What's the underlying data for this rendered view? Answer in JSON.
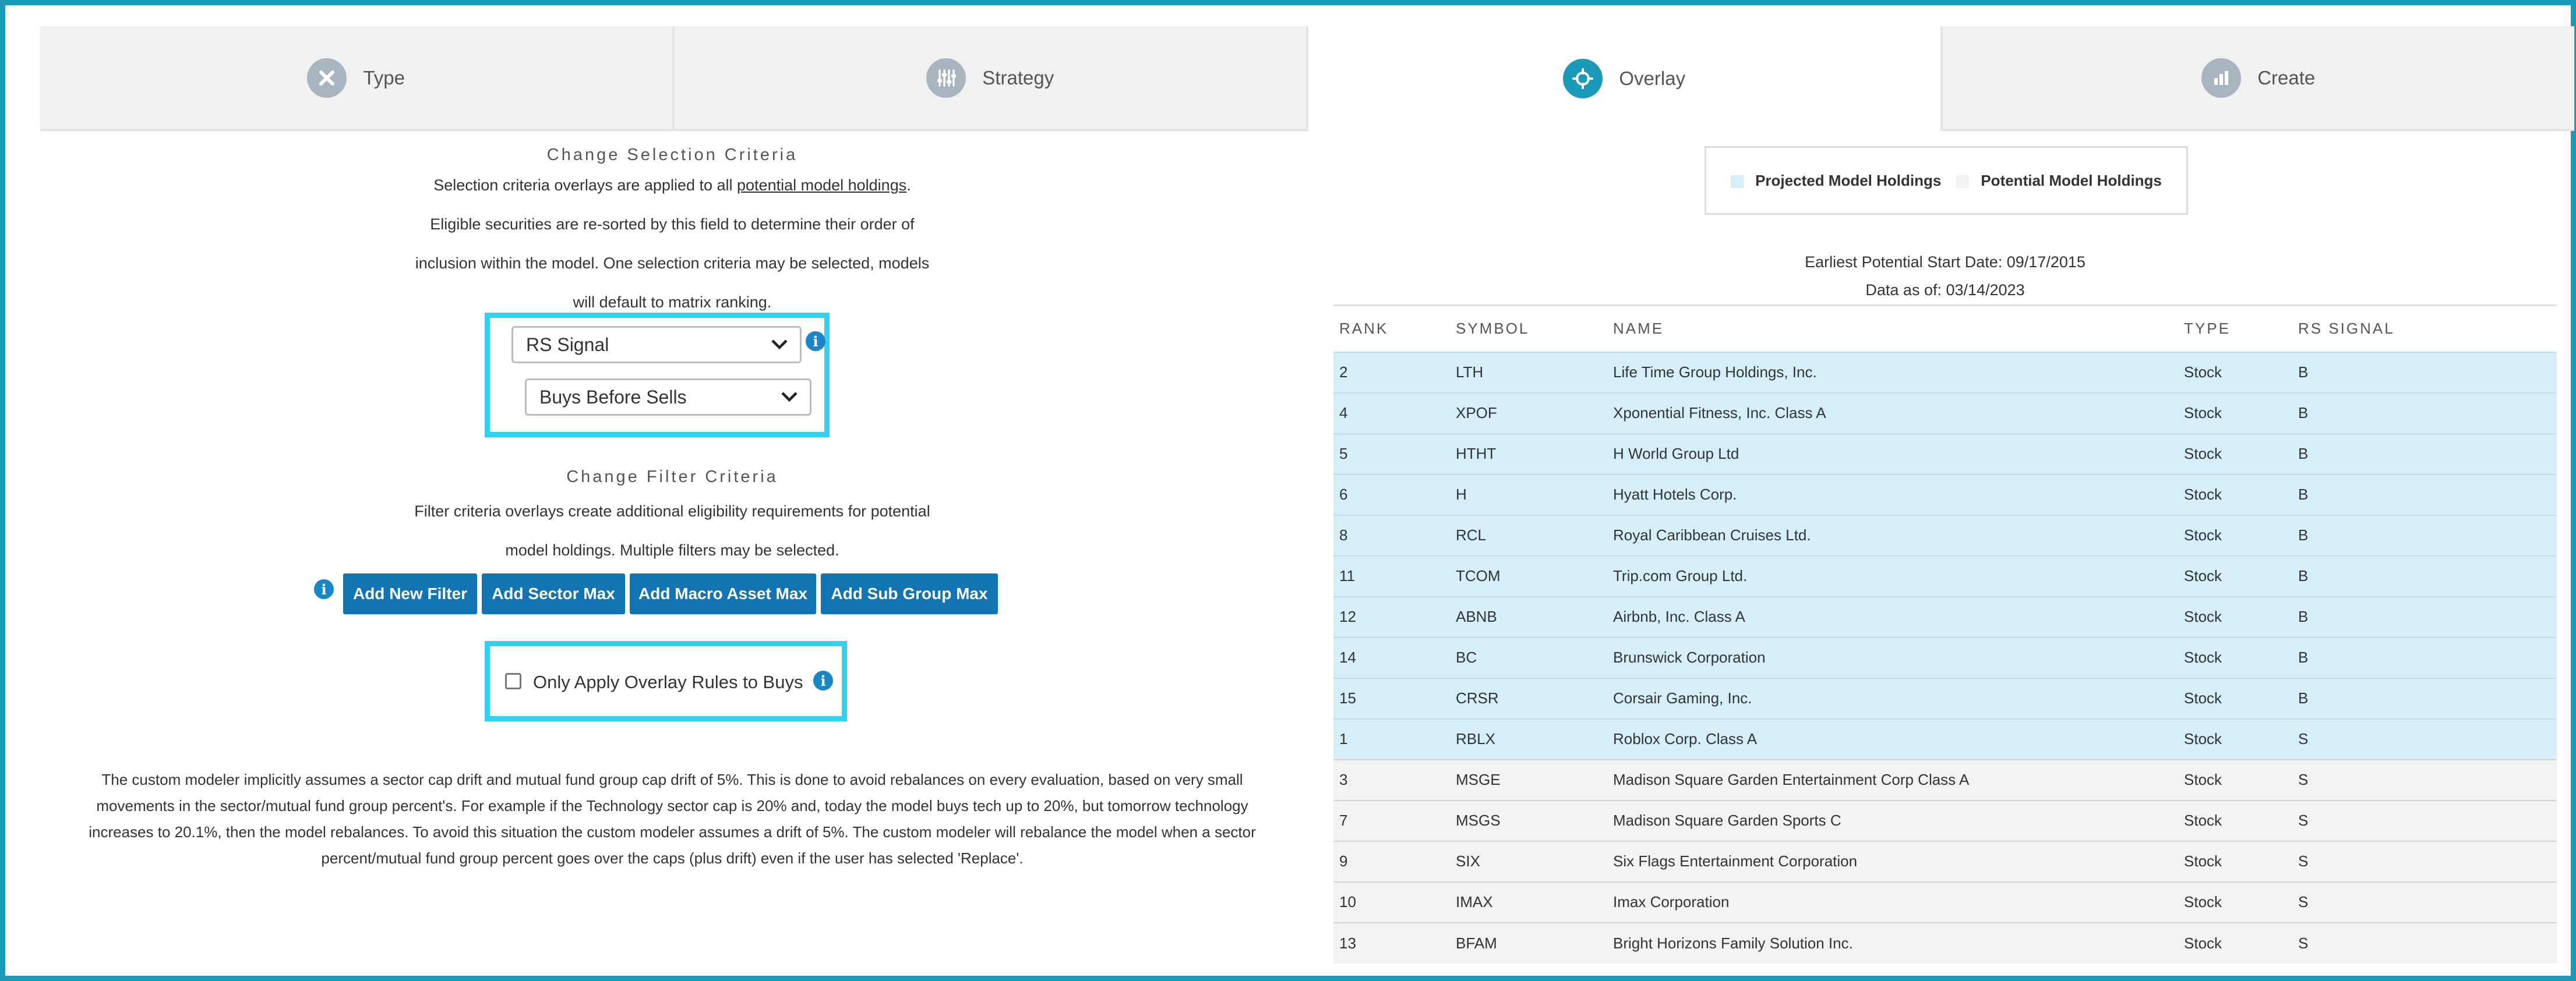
{
  "tabs": [
    {
      "label": "Type",
      "icon": "tools-icon",
      "active": false
    },
    {
      "label": "Strategy",
      "icon": "sliders-icon",
      "active": false
    },
    {
      "label": "Overlay",
      "icon": "target-icon",
      "active": true
    },
    {
      "label": "Create",
      "icon": "bar-chart-icon",
      "active": false
    }
  ],
  "selection": {
    "title": "Change Selection Criteria",
    "line1_prefix": "Selection criteria overlays are applied to all ",
    "line1_link": "potential model holdings",
    "line1_suffix": ".",
    "line2": "Eligible securities are re-sorted by this field to determine their order of",
    "line3": "inclusion within the model. One selection criteria may be selected, models",
    "line4": "will default to matrix ranking.",
    "criteria_value": "RS Signal",
    "order_value": "Buys Before Sells"
  },
  "filter": {
    "title": "Change Filter Criteria",
    "line1": "Filter criteria overlays create additional eligibility requirements for potential",
    "line2": "model holdings. Multiple filters may be selected.",
    "buttons": [
      "Add New Filter",
      "Add Sector Max",
      "Add Macro Asset Max",
      "Add Sub Group Max"
    ],
    "only_buys_label": "Only Apply Overlay Rules to Buys"
  },
  "footnote": {
    "line1": "The custom modeler implicitly assumes a sector cap drift and mutual fund group cap drift of 5%. This is done to avoid rebalances on every evaluation, based on very small",
    "line2": "movements in the sector/mutual fund group percent's. For example if the Technology sector cap is 20% and, today the model buys tech up to 20%, but tomorrow technology",
    "line3": "increases to 20.1%, then the model rebalances. To avoid this situation the custom modeler assumes a drift of 5%. The custom modeler will rebalance the model when a sector",
    "line4": "percent/mutual fund group percent goes over the caps (plus drift) even if the user has selected 'Replace'."
  },
  "legend": {
    "projected": "Projected Model Holdings",
    "potential": "Potential Model Holdings",
    "projected_color": "#d6eef8",
    "potential_color": "#f2f2f2"
  },
  "meta": {
    "start_date": "Earliest Potential Start Date: 09/17/2015",
    "data_as_of": "Data as of: 03/14/2023"
  },
  "table": {
    "headers": [
      "RANK",
      "SYMBOL",
      "NAME",
      "TYPE",
      "RS SIGNAL"
    ],
    "rows": [
      {
        "rank": "2",
        "symbol": "LTH",
        "name": "Life Time Group Holdings, Inc.",
        "type": "Stock",
        "signal": "B",
        "group": "projected"
      },
      {
        "rank": "4",
        "symbol": "XPOF",
        "name": "Xponential Fitness, Inc. Class A",
        "type": "Stock",
        "signal": "B",
        "group": "projected"
      },
      {
        "rank": "5",
        "symbol": "HTHT",
        "name": "H World Group Ltd",
        "type": "Stock",
        "signal": "B",
        "group": "projected"
      },
      {
        "rank": "6",
        "symbol": "H",
        "name": "Hyatt Hotels Corp.",
        "type": "Stock",
        "signal": "B",
        "group": "projected"
      },
      {
        "rank": "8",
        "symbol": "RCL",
        "name": "Royal Caribbean Cruises Ltd.",
        "type": "Stock",
        "signal": "B",
        "group": "projected"
      },
      {
        "rank": "11",
        "symbol": "TCOM",
        "name": "Trip.com Group Ltd.",
        "type": "Stock",
        "signal": "B",
        "group": "projected"
      },
      {
        "rank": "12",
        "symbol": "ABNB",
        "name": "Airbnb, Inc. Class A",
        "type": "Stock",
        "signal": "B",
        "group": "projected"
      },
      {
        "rank": "14",
        "symbol": "BC",
        "name": "Brunswick Corporation",
        "type": "Stock",
        "signal": "B",
        "group": "projected"
      },
      {
        "rank": "15",
        "symbol": "CRSR",
        "name": "Corsair Gaming, Inc.",
        "type": "Stock",
        "signal": "B",
        "group": "projected"
      },
      {
        "rank": "1",
        "symbol": "RBLX",
        "name": "Roblox Corp. Class A",
        "type": "Stock",
        "signal": "S",
        "group": "projected"
      },
      {
        "rank": "3",
        "symbol": "MSGE",
        "name": "Madison Square Garden Entertainment Corp Class A",
        "type": "Stock",
        "signal": "S",
        "group": "potential"
      },
      {
        "rank": "7",
        "symbol": "MSGS",
        "name": "Madison Square Garden Sports C",
        "type": "Stock",
        "signal": "S",
        "group": "potential"
      },
      {
        "rank": "9",
        "symbol": "SIX",
        "name": "Six Flags Entertainment Corporation",
        "type": "Stock",
        "signal": "S",
        "group": "potential"
      },
      {
        "rank": "10",
        "symbol": "IMAX",
        "name": "Imax Corporation",
        "type": "Stock",
        "signal": "S",
        "group": "potential"
      },
      {
        "rank": "13",
        "symbol": "BFAM",
        "name": "Bright Horizons Family Solution Inc.",
        "type": "Stock",
        "signal": "S",
        "group": "potential"
      }
    ]
  }
}
